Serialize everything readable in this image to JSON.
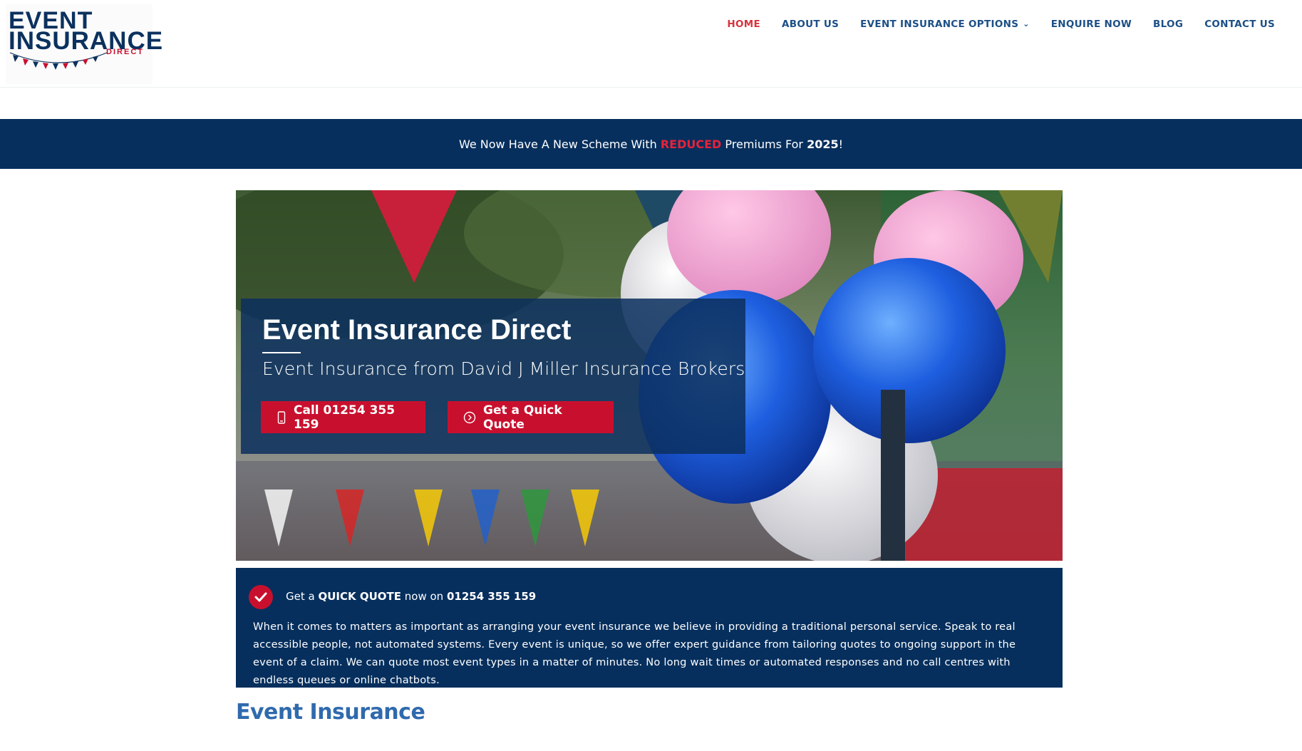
{
  "logo": {
    "line1": "EVENT",
    "line2": "INSURANCE",
    "tagline": "DIRECT",
    "colors": {
      "navy": "#0b315e",
      "red": "#c8102e"
    }
  },
  "nav": {
    "items": [
      {
        "label": "HOME",
        "active": true
      },
      {
        "label": "ABOUT US",
        "active": false
      },
      {
        "label": "EVENT INSURANCE OPTIONS",
        "active": false,
        "has_dropdown": true,
        "icon": "chevron-down-icon"
      },
      {
        "label": "ENQUIRE NOW",
        "active": false
      },
      {
        "label": "BLOG",
        "active": false
      },
      {
        "label": "CONTACT US",
        "active": false
      }
    ]
  },
  "announcement": {
    "prefix": "We Now Have A New Scheme With ",
    "highlight": "REDUCED",
    "middle": " Premiums For ",
    "year": "2025",
    "suffix": "!"
  },
  "hero": {
    "title": "Event Insurance Direct",
    "subtitle": "Event Insurance from David J Miller Insurance Brokers",
    "call_button": {
      "label": "Call 01254 355 159",
      "icon": "phone-icon"
    },
    "quote_button": {
      "label": "Get a Quick Quote",
      "icon": "arrow-circle-icon"
    }
  },
  "quick_quote": {
    "prefix": "Get a ",
    "strong": "QUICK QUOTE",
    "middle": " now on ",
    "phone": "01254 355 159",
    "icon": "check-icon",
    "body": "When it comes to matters as important as arranging your event insurance we believe in providing a traditional personal service. Speak to real accessible people, not automated systems. Every event is unique, so we offer expert guidance from tailoring quotes to ongoing support in the event of a claim. We can quote most event types in a matter of minutes. No long wait times or automated responses and no call centres with endless queues or online chatbots."
  },
  "section": {
    "title": "Event Insurance"
  },
  "colors": {
    "navy": "#062f5d",
    "accent_red": "#c8102e",
    "nav_blue": "#1c4f86",
    "nav_active": "#d5343e",
    "heading_blue": "#2f6aad"
  }
}
